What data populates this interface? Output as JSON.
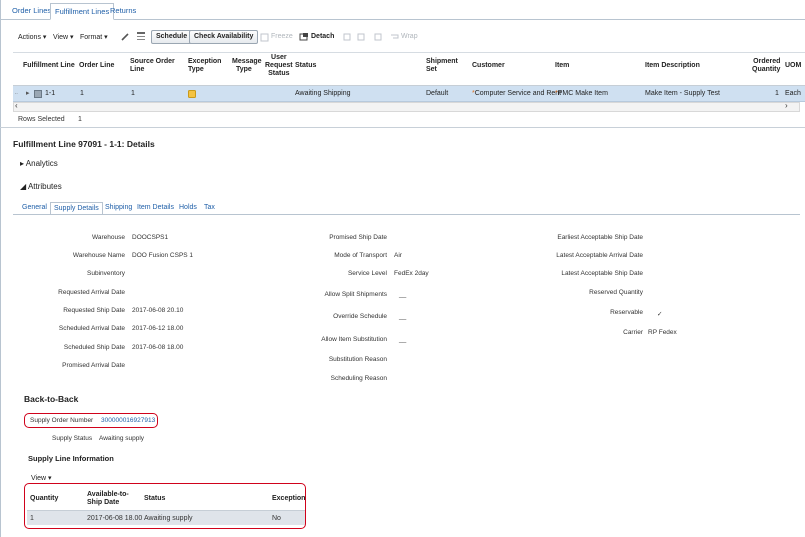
{
  "tabs": [
    {
      "label": "Order Lines",
      "active": false
    },
    {
      "label": "Fulfillment Lines",
      "active": true
    },
    {
      "label": "Returns",
      "active": false
    }
  ],
  "toolbar": {
    "actions": "Actions",
    "view": "View",
    "format": "Format",
    "schedule": "Schedule",
    "check_availability": "Check Availability",
    "freeze": "Freeze",
    "detach": "Detach",
    "wrap": "Wrap"
  },
  "grid": {
    "columns": {
      "fulfillment_line": "Fulfillment Line",
      "order_line": "Order Line",
      "source_order_line_1": "Source Order",
      "source_order_line_2": "Line",
      "exception_type_1": "Exception",
      "exception_type_2": "Type",
      "message_type_1": "Message",
      "message_type_2": "Type",
      "user_request_status_1": "User",
      "user_request_status_2": "Request",
      "user_request_status_3": "Status",
      "status": "Status",
      "shipment_set_1": "Shipment",
      "shipment_set_2": "Set",
      "customer": "Customer",
      "item": "Item",
      "item_description": "Item Description",
      "ordered_quantity_1": "Ordered",
      "ordered_quantity_2": "Quantity",
      "uom": "UOM"
    },
    "row": {
      "fulfillment_line": "1-1",
      "order_line": "1",
      "source_order_line": "1",
      "status": "Awaiting Shipping",
      "shipment_set": "Default",
      "customer": "Computer Service and Rent",
      "item": "PMC Make Item",
      "item_description": "Make Item - Supply Test",
      "ordered_quantity": "1",
      "uom": "Each"
    },
    "rows_selected_label": "Rows Selected",
    "rows_selected_value": "1"
  },
  "details": {
    "title": "Fulfillment Line 97091 - 1-1: Details",
    "analytics": "Analytics",
    "attributes": "Attributes",
    "subtabs": [
      "General",
      "Supply Details",
      "Shipping",
      "Item Details",
      "Holds",
      "Tax"
    ],
    "col1": [
      {
        "label": "Warehouse",
        "value": "DOOCSPS1"
      },
      {
        "label": "Warehouse Name",
        "value": "DOO Fusion CSPS 1"
      },
      {
        "label": "Subinventory",
        "value": ""
      },
      {
        "label": "Requested Arrival Date",
        "value": ""
      },
      {
        "label": "Requested Ship Date",
        "value": "2017-06-08 20.10"
      },
      {
        "label": "Scheduled Arrival Date",
        "value": "2017-06-12 18.00"
      },
      {
        "label": "Scheduled Ship Date",
        "value": "2017-06-08 18.00"
      },
      {
        "label": "Promised Arrival Date",
        "value": ""
      }
    ],
    "col2": [
      {
        "label": "Promised Ship Date",
        "value": ""
      },
      {
        "label": "Mode of Transport",
        "value": "Air"
      },
      {
        "label": "Service Level",
        "value": "FedEx 2day"
      },
      {
        "label": "Allow Split Shipments",
        "value": "__"
      },
      {
        "label": "Override Schedule",
        "value": "__"
      },
      {
        "label": "Allow Item Substitution",
        "value": "__"
      },
      {
        "label": "Substitution Reason",
        "value": ""
      },
      {
        "label": "Scheduling Reason",
        "value": ""
      }
    ],
    "col3": [
      {
        "label": "Earliest Acceptable Ship Date",
        "value": ""
      },
      {
        "label": "Latest Acceptable Arrival Date",
        "value": ""
      },
      {
        "label": "Latest Acceptable Ship Date",
        "value": ""
      },
      {
        "label": "Reserved Quantity",
        "value": ""
      },
      {
        "label": "Reservable",
        "value": "✓"
      },
      {
        "label": "Carrier",
        "value": "RP Fedex"
      }
    ]
  },
  "back_to_back": {
    "title": "Back-to-Back",
    "supply_order_number_label": "Supply Order Number",
    "supply_order_number": "300000016927913",
    "supply_status_label": "Supply Status",
    "supply_status": "Awaiting supply",
    "supply_line_info_title": "Supply Line Information",
    "view": "View",
    "columns": {
      "quantity": "Quantity",
      "available_1": "Available-to-",
      "available_2": "Ship Date",
      "status": "Status",
      "exception": "Exception"
    },
    "row": {
      "quantity": "1",
      "available": "2017-06-08 18.00",
      "status": "Awaiting supply",
      "exception": "No"
    }
  },
  "colors": {
    "link": "#1f5fa8",
    "selected_row": "#cfe0f1",
    "highlight_box": "#d0021b",
    "exception_icon": "#f5c342"
  }
}
